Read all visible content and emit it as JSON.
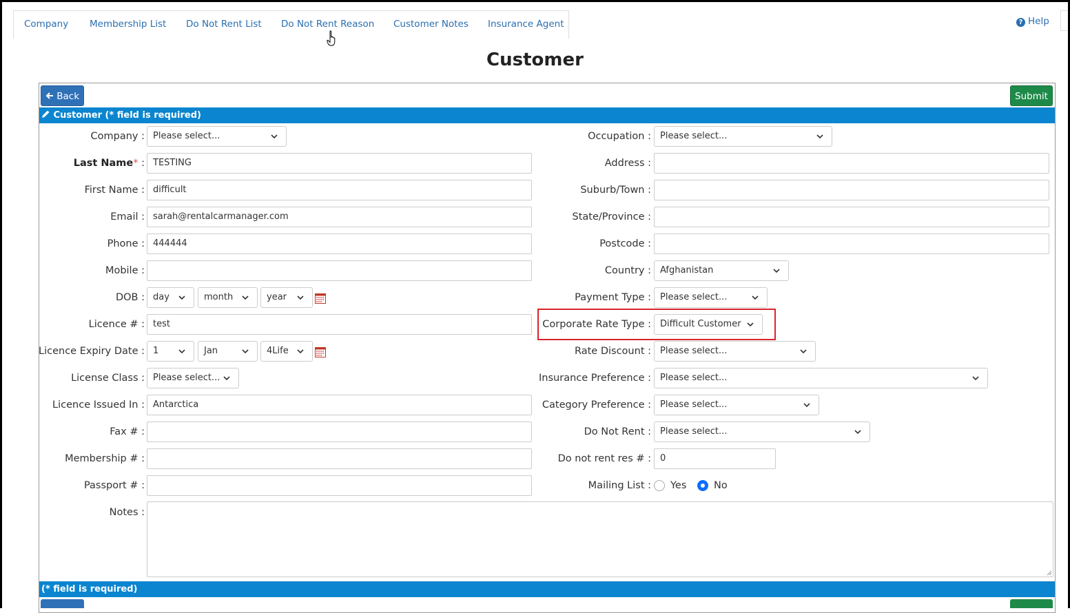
{
  "nav": {
    "tabs": [
      {
        "label": "Company"
      },
      {
        "label": "Membership List"
      },
      {
        "label": "Do Not Rent List"
      },
      {
        "label": "Do Not Rent Reason"
      },
      {
        "label": "Customer Notes"
      },
      {
        "label": "Insurance Agent"
      }
    ],
    "help_label": "Help"
  },
  "page": {
    "title": "Customer"
  },
  "toolbar": {
    "back_label": "Back",
    "submit_label": "Submit"
  },
  "section": {
    "header": "Customer (* field is required)",
    "footer": "(* field is required)"
  },
  "left": {
    "company": {
      "label": "Company :",
      "value": "Please select..."
    },
    "last_name": {
      "label": "Last Name",
      "req": "*",
      "colon": " :",
      "value": "TESTING"
    },
    "first_name": {
      "label": "First Name :",
      "value": "difficult"
    },
    "email": {
      "label": "Email :",
      "value": "sarah@rentalcarmanager.com"
    },
    "phone": {
      "label": "Phone :",
      "value": "444444"
    },
    "mobile": {
      "label": "Mobile :",
      "value": ""
    },
    "dob": {
      "label": "DOB :",
      "day": "day",
      "month": "month",
      "year": "year"
    },
    "licence": {
      "label": "Licence # :",
      "value": "test"
    },
    "licence_expiry": {
      "label": "Licence Expiry Date :",
      "day": "1",
      "month": "Jan",
      "year": "4Life"
    },
    "license_class": {
      "label": "License Class :",
      "value": "Please select..."
    },
    "licence_issued": {
      "label": "Licence Issued In :",
      "value": "Antarctica"
    },
    "fax": {
      "label": "Fax # :",
      "value": ""
    },
    "membership": {
      "label": "Membership # :",
      "value": ""
    },
    "passport": {
      "label": "Passport # :",
      "value": ""
    },
    "notes": {
      "label": "Notes :",
      "value": ""
    }
  },
  "right": {
    "occupation": {
      "label": "Occupation :",
      "value": "Please select..."
    },
    "address": {
      "label": "Address :",
      "value": ""
    },
    "suburb": {
      "label": "Suburb/Town :",
      "value": ""
    },
    "state": {
      "label": "State/Province :",
      "value": ""
    },
    "postcode": {
      "label": "Postcode :",
      "value": ""
    },
    "country": {
      "label": "Country :",
      "value": "Afghanistan"
    },
    "payment_type": {
      "label": "Payment Type :",
      "value": "Please select..."
    },
    "corporate_rate": {
      "label": "Corporate Rate Type :",
      "value": "Difficult Customer"
    },
    "rate_discount": {
      "label": "Rate Discount :",
      "value": "Please select..."
    },
    "insurance_pref": {
      "label": "Insurance Preference :",
      "value": "Please select..."
    },
    "category_pref": {
      "label": "Category Preference :",
      "value": "Please select..."
    },
    "do_not_rent": {
      "label": "Do Not Rent :",
      "value": "Please select..."
    },
    "do_not_rent_res": {
      "label": "Do not rent res # :",
      "value": "0"
    },
    "mailing_list": {
      "label": "Mailing List :",
      "yes": "Yes",
      "no": "No",
      "selected": "No"
    }
  },
  "colors": {
    "accent": "#0b85cf",
    "back_button": "#2f71b7",
    "submit_button": "#1e8a49",
    "highlight": "#d9232a"
  }
}
